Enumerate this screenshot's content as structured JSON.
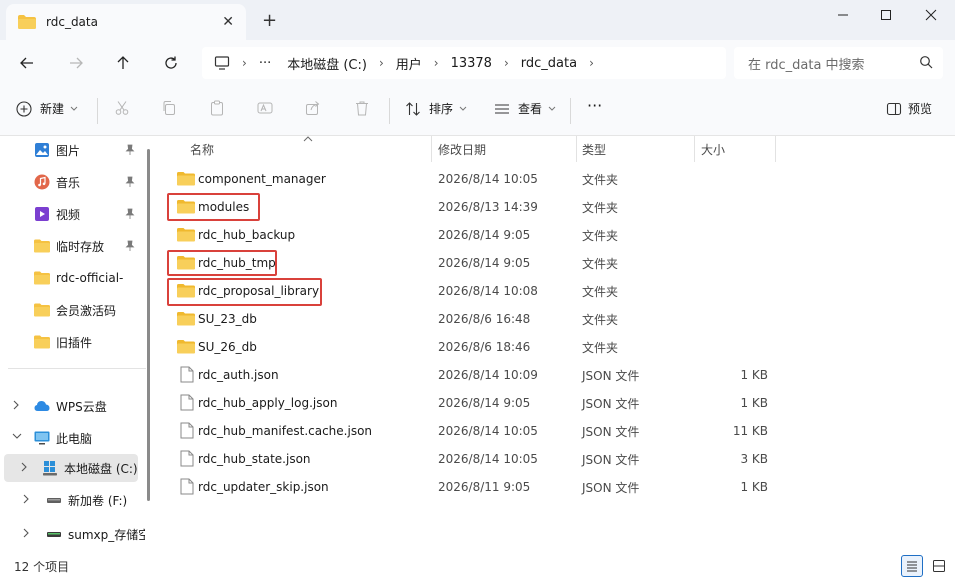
{
  "window": {
    "tab_title": "rdc_data",
    "tab_close": "✕",
    "new_tab": "+",
    "minimize": "—",
    "maximize": "☐",
    "close": "✕"
  },
  "address": {
    "more": "···",
    "crumbs": [
      "本地磁盘 (C:)",
      "用户",
      "13378",
      "rdc_data"
    ],
    "search_placeholder": "在 rdc_data 中搜索"
  },
  "toolbar": {
    "new_label": "新建",
    "sort_label": "排序",
    "view_label": "查看",
    "more_label": "···",
    "preview_label": "预览"
  },
  "sidebar": {
    "quick_items": [
      {
        "label": "图片",
        "icon": "pictures-icon"
      },
      {
        "label": "音乐",
        "icon": "music-icon"
      },
      {
        "label": "视频",
        "icon": "videos-icon"
      },
      {
        "label": "临时存放",
        "icon": "folder-icon"
      },
      {
        "label": "rdc-official-",
        "icon": "folder-icon"
      },
      {
        "label": "会员激活码",
        "icon": "folder-icon"
      },
      {
        "label": "旧插件",
        "icon": "folder-icon"
      }
    ],
    "tree_items": [
      {
        "label": "WPS云盘",
        "icon": "cloud-icon"
      },
      {
        "label": "此电脑",
        "icon": "computer-icon"
      },
      {
        "label": "本地磁盘 (C:)",
        "icon": "windows-drive-icon"
      },
      {
        "label": "新加卷 (F:)",
        "icon": "drive-icon"
      },
      {
        "label": "sumxp_存储空",
        "icon": "drive-icon"
      }
    ]
  },
  "columns": {
    "name": "名称",
    "date": "修改日期",
    "type": "类型",
    "size": "大小"
  },
  "files": [
    {
      "name": "component_manager",
      "date": "2026/8/14 10:05",
      "type": "文件夹",
      "size": "",
      "kind": "folder"
    },
    {
      "name": "modules",
      "date": "2026/8/13 14:39",
      "type": "文件夹",
      "size": "",
      "kind": "folder"
    },
    {
      "name": "rdc_hub_backup",
      "date": "2026/8/14 9:05",
      "type": "文件夹",
      "size": "",
      "kind": "folder"
    },
    {
      "name": "rdc_hub_tmp",
      "date": "2026/8/14 9:05",
      "type": "文件夹",
      "size": "",
      "kind": "folder"
    },
    {
      "name": "rdc_proposal_library",
      "date": "2026/8/14 10:08",
      "type": "文件夹",
      "size": "",
      "kind": "folder"
    },
    {
      "name": "SU_23_db",
      "date": "2026/8/6 16:48",
      "type": "文件夹",
      "size": "",
      "kind": "folder"
    },
    {
      "name": "SU_26_db",
      "date": "2026/8/6 18:46",
      "type": "文件夹",
      "size": "",
      "kind": "folder"
    },
    {
      "name": "rdc_auth.json",
      "date": "2026/8/14 10:09",
      "type": "JSON 文件",
      "size": "1 KB",
      "kind": "file"
    },
    {
      "name": "rdc_hub_apply_log.json",
      "date": "2026/8/14 9:05",
      "type": "JSON 文件",
      "size": "1 KB",
      "kind": "file"
    },
    {
      "name": "rdc_hub_manifest.cache.json",
      "date": "2026/8/14 10:05",
      "type": "JSON 文件",
      "size": "11 KB",
      "kind": "file"
    },
    {
      "name": "rdc_hub_state.json",
      "date": "2026/8/14 10:05",
      "type": "JSON 文件",
      "size": "3 KB",
      "kind": "file"
    },
    {
      "name": "rdc_updater_skip.json",
      "date": "2026/8/11 9:05",
      "type": "JSON 文件",
      "size": "1 KB",
      "kind": "file"
    }
  ],
  "status": {
    "item_count": "12 个项目"
  },
  "colors": {
    "highlight": "#d9413b",
    "folder": "#f5c242",
    "accent": "#1f6fc5"
  }
}
